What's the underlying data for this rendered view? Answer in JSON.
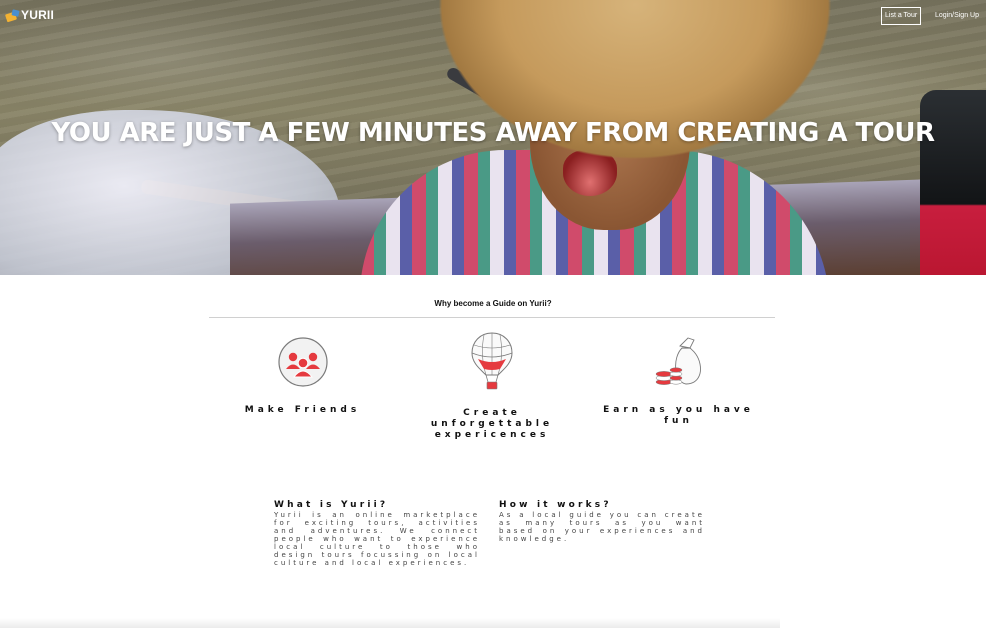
{
  "brand": {
    "logo_text": "YURII"
  },
  "nav": {
    "list_tour_label": "List a Tour",
    "login_label": "Login/Sign Up"
  },
  "hero": {
    "headline": "YOU ARE JUST A FEW MINUTES AWAY FROM CREATING A TOUR"
  },
  "why": {
    "title": "Why become a Guide on Yurii?",
    "features": [
      {
        "icon": "friends-icon",
        "label": "Make Friends"
      },
      {
        "icon": "hot-air-balloon-icon",
        "label": "Create unforgettable expericences"
      },
      {
        "icon": "money-bag-icon",
        "label": "Earn as you have fun"
      }
    ]
  },
  "info": {
    "what": {
      "title": "What is Yurii?",
      "body": "Yurii is an online marketplace for exciting tours, activities and adventures. We connect people who want to experience local culture to those who design tours focussing on local culture and local experiences."
    },
    "how": {
      "title": "How it works?",
      "body": "As a local guide you can create as many tours as you want based on your experiences and knowledge."
    }
  },
  "colors": {
    "accent": "#e53a3f",
    "hero_text": "#ffffff",
    "icon_outline": "#7a7a7a"
  }
}
